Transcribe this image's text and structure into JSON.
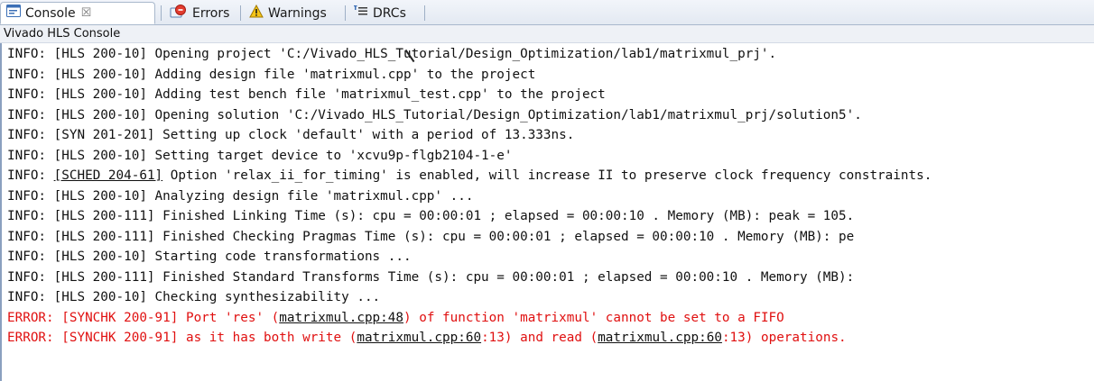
{
  "tabs": {
    "console": {
      "label": "Console",
      "close": "☒"
    },
    "errors": {
      "label": "Errors"
    },
    "warnings": {
      "label": "Warnings"
    },
    "drcs": {
      "label": "DRCs"
    }
  },
  "console": {
    "title": "Vivado HLS Console",
    "lines": [
      {
        "type": "info",
        "parts": [
          {
            "t": "INFO: [HLS 200-10] Opening project 'C:/Vivado_HLS_Tutorial/Design_Optimization/lab1/matrixmul_prj'."
          }
        ]
      },
      {
        "type": "info",
        "parts": [
          {
            "t": "INFO: [HLS 200-10] Adding design file 'matrixmul.cpp' to the project"
          }
        ]
      },
      {
        "type": "info",
        "parts": [
          {
            "t": "INFO: [HLS 200-10] Adding test bench file 'matrixmul_test.cpp' to the project"
          }
        ]
      },
      {
        "type": "info",
        "parts": [
          {
            "t": "INFO: [HLS 200-10] Opening solution 'C:/Vivado_HLS_Tutorial/Design_Optimization/lab1/matrixmul_prj/solution5'."
          }
        ]
      },
      {
        "type": "info",
        "parts": [
          {
            "t": "INFO: [SYN 201-201] Setting up clock 'default' with a period of 13.333ns."
          }
        ]
      },
      {
        "type": "info",
        "parts": [
          {
            "t": "INFO: [HLS 200-10] Setting target device to 'xcvu9p-flgb2104-1-e'"
          }
        ]
      },
      {
        "type": "info",
        "parts": [
          {
            "t": "INFO: "
          },
          {
            "t": "[SCHED 204-61]",
            "link": true
          },
          {
            "t": " Option 'relax_ii_for_timing' is enabled, will increase II to preserve clock frequency constraints."
          }
        ]
      },
      {
        "type": "info",
        "parts": [
          {
            "t": "INFO: [HLS 200-10] Analyzing design file 'matrixmul.cpp' ..."
          }
        ]
      },
      {
        "type": "info",
        "parts": [
          {
            "t": "INFO: [HLS 200-111] Finished Linking Time (s): cpu = 00:00:01 ; elapsed = 00:00:10 . Memory (MB): peak = 105."
          }
        ]
      },
      {
        "type": "info",
        "parts": [
          {
            "t": "INFO: [HLS 200-111] Finished Checking Pragmas Time (s): cpu = 00:00:01 ; elapsed = 00:00:10 . Memory (MB): pe"
          }
        ]
      },
      {
        "type": "info",
        "parts": [
          {
            "t": "INFO: [HLS 200-10] Starting code transformations ..."
          }
        ]
      },
      {
        "type": "info",
        "parts": [
          {
            "t": "INFO: [HLS 200-111] Finished Standard Transforms Time (s): cpu = 00:00:01 ; elapsed = 00:00:10 . Memory (MB):"
          }
        ]
      },
      {
        "type": "info",
        "parts": [
          {
            "t": "INFO: [HLS 200-10] Checking synthesizability ..."
          }
        ]
      },
      {
        "type": "error",
        "parts": [
          {
            "t": "ERROR: [SYNCHK 200-91] Port 'res' ("
          },
          {
            "t": "matrixmul.cpp:48",
            "link": true
          },
          {
            "t": ") of function 'matrixmul' cannot be set to a FIFO"
          }
        ]
      },
      {
        "type": "error",
        "parts": [
          {
            "t": "ERROR: [SYNCHK 200-91] as it has both write ("
          },
          {
            "t": "matrixmul.cpp:60",
            "link": true
          },
          {
            "t": ":13) and read ("
          },
          {
            "t": "matrixmul.cpp:60",
            "link": true
          },
          {
            "t": ":13) operations."
          }
        ]
      }
    ]
  },
  "colors": {
    "error": "#e01010",
    "info": "#111111",
    "tab_border": "#a9b8cc"
  },
  "icons": {
    "console": "console-icon",
    "errors": "errors-icon",
    "warnings": "warning-icon",
    "drcs": "drc-icon"
  }
}
